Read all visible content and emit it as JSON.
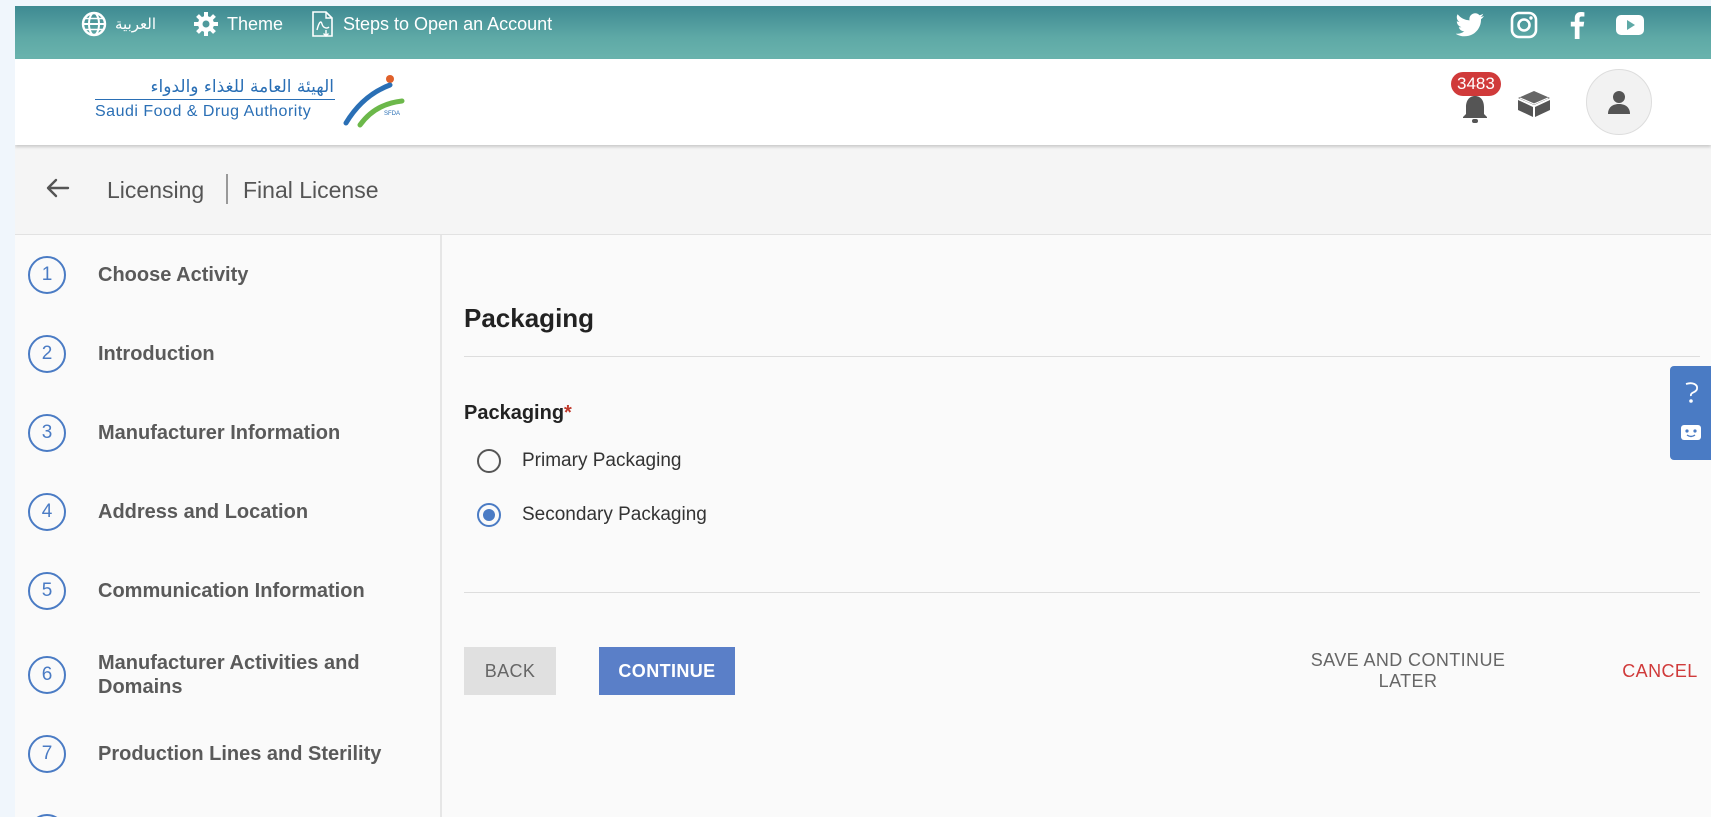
{
  "topbar": {
    "language_label": "العربية",
    "theme_label": "Theme",
    "steps_label": "Steps to Open an Account",
    "social": [
      "twitter-icon",
      "instagram-icon",
      "facebook-icon",
      "youtube-icon"
    ]
  },
  "header": {
    "logo_arabic": "الهيئة العامة للغذاء والدواء",
    "logo_english": "Saudi Food & Drug Authority",
    "logo_mark_text": "SFDA",
    "notification_count": "3483"
  },
  "breadcrumb": {
    "section": "Licensing",
    "page": "Final License"
  },
  "steps": [
    {
      "num": "1",
      "label": "Choose Activity"
    },
    {
      "num": "2",
      "label": "Introduction"
    },
    {
      "num": "3",
      "label": "Manufacturer Information"
    },
    {
      "num": "4",
      "label": "Address and Location"
    },
    {
      "num": "5",
      "label": "Communication Information"
    },
    {
      "num": "6",
      "label": "Manufacturer Activities and Domains"
    },
    {
      "num": "7",
      "label": "Production Lines and Sterility"
    }
  ],
  "form": {
    "section_title": "Packaging",
    "field_label": "Packaging",
    "required_mark": "*",
    "options": [
      {
        "label": "Primary Packaging",
        "selected": false
      },
      {
        "label": "Secondary Packaging",
        "selected": true
      }
    ]
  },
  "actions": {
    "back": "BACK",
    "continue": "CONTINUE",
    "save_later": "SAVE AND CONTINUE LATER",
    "cancel": "CANCEL"
  },
  "colors": {
    "accent": "#4a7bc4",
    "danger": "#d03a3a",
    "topbar": "#5ea9a6"
  }
}
